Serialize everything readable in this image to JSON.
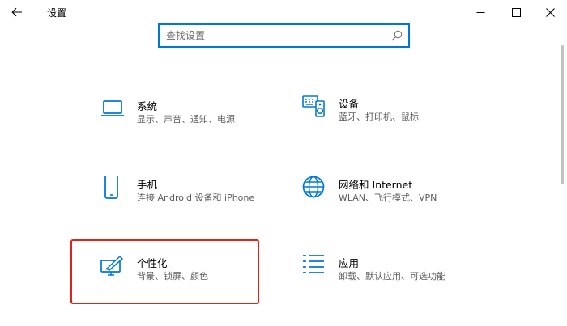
{
  "window": {
    "title": "设置",
    "controls": {
      "back_icon": "arrow-left-icon",
      "minimize_icon": "minimize-icon",
      "maximize_icon": "maximize-icon",
      "close_icon": "close-icon"
    }
  },
  "search": {
    "placeholder": "查找设置",
    "value": "",
    "icon": "search-icon"
  },
  "tiles": [
    {
      "icon": "laptop-icon",
      "title": "系统",
      "desc": "显示、声音、通知、电源"
    },
    {
      "icon": "keyboard-speaker-icon",
      "title": "设备",
      "desc": "蓝牙、打印机、鼠标"
    },
    {
      "icon": "phone-icon",
      "title": "手机",
      "desc": "连接 Android 设备和 iPhone"
    },
    {
      "icon": "globe-icon",
      "title": "网络和 Internet",
      "desc": "WLAN、飞行模式、VPN"
    },
    {
      "icon": "paint-screen-icon",
      "title": "个性化",
      "desc": "背景、锁屏、颜色"
    },
    {
      "icon": "apps-list-icon",
      "title": "应用",
      "desc": "卸载、默认应用、可选功能"
    }
  ],
  "colors": {
    "accent": "#0078d7",
    "highlight": "#e0201b"
  }
}
